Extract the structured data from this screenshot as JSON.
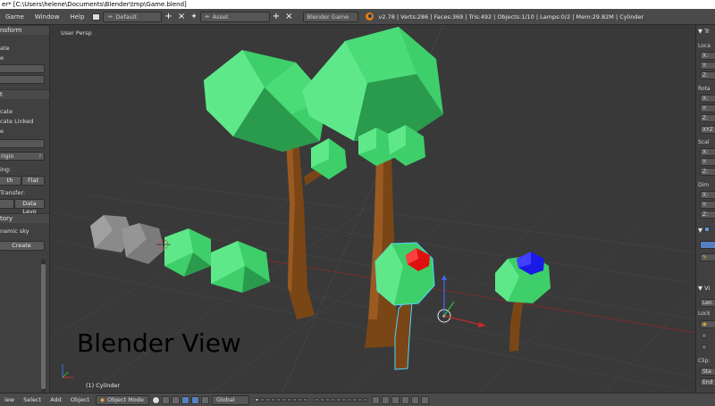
{
  "window": {
    "title": "er* [C:\\Users\\helene\\Documents\\Blender\\tmp\\Game.blend]"
  },
  "info_header": {
    "menus": [
      "Game",
      "Window",
      "Help"
    ],
    "screen_layout": "Default",
    "scene": "Asset",
    "render_engine": "Blender Game",
    "stats": "v2.78 | Verts:286 | Faces:369 | Tris:492 | Objects:1/10 | Lamps:0/2 | Mem:29.82M | Cylinder"
  },
  "left_panel": {
    "transform_header": "nsform",
    "transform_items": [
      "ate",
      "e"
    ],
    "edit_header": "t",
    "edit_items": [
      "cate",
      "cate Linked",
      "e"
    ],
    "origin_label": "rigin",
    "shading_label": "ing:",
    "smooth_label": "th",
    "flat_label": "Flat",
    "data_transfer_label": "Transfer:",
    "data_layo_label": "Data Layo",
    "history_header": "tory",
    "dynamic_sky_label": "namic sky",
    "create_label": "Create"
  },
  "viewport": {
    "view_label": "User Persp",
    "object_info": "(1) Cylinder",
    "overlay_text": "Blender View"
  },
  "right_panel": {
    "transform_header": "Tr",
    "location_label": "Loca",
    "rotation_label": "Rota",
    "rotation_mode": "XYZ",
    "scale_label": "Scal",
    "dimensions_label": "Dim",
    "axes": [
      "X:",
      "Y:",
      "Z:"
    ],
    "view_header": "Vi",
    "lens_label": "Len",
    "lock_label": "Lock",
    "clip_label": "Clip:",
    "clip_start": "Sta",
    "clip_end": "End"
  },
  "bottom_header": {
    "menus": [
      "iew",
      "Select",
      "Add",
      "Object"
    ],
    "mode": "Object Mode",
    "pivot_orientation": "Global"
  },
  "colors": {
    "tree_green": "#3ecf6a",
    "trunk_brown": "#7a4616",
    "selection_outline": "#4fd6ff",
    "red_gem": "#e01010",
    "blue_gem": "#1a1ae6",
    "rock_grey": "#8a8a8a"
  }
}
